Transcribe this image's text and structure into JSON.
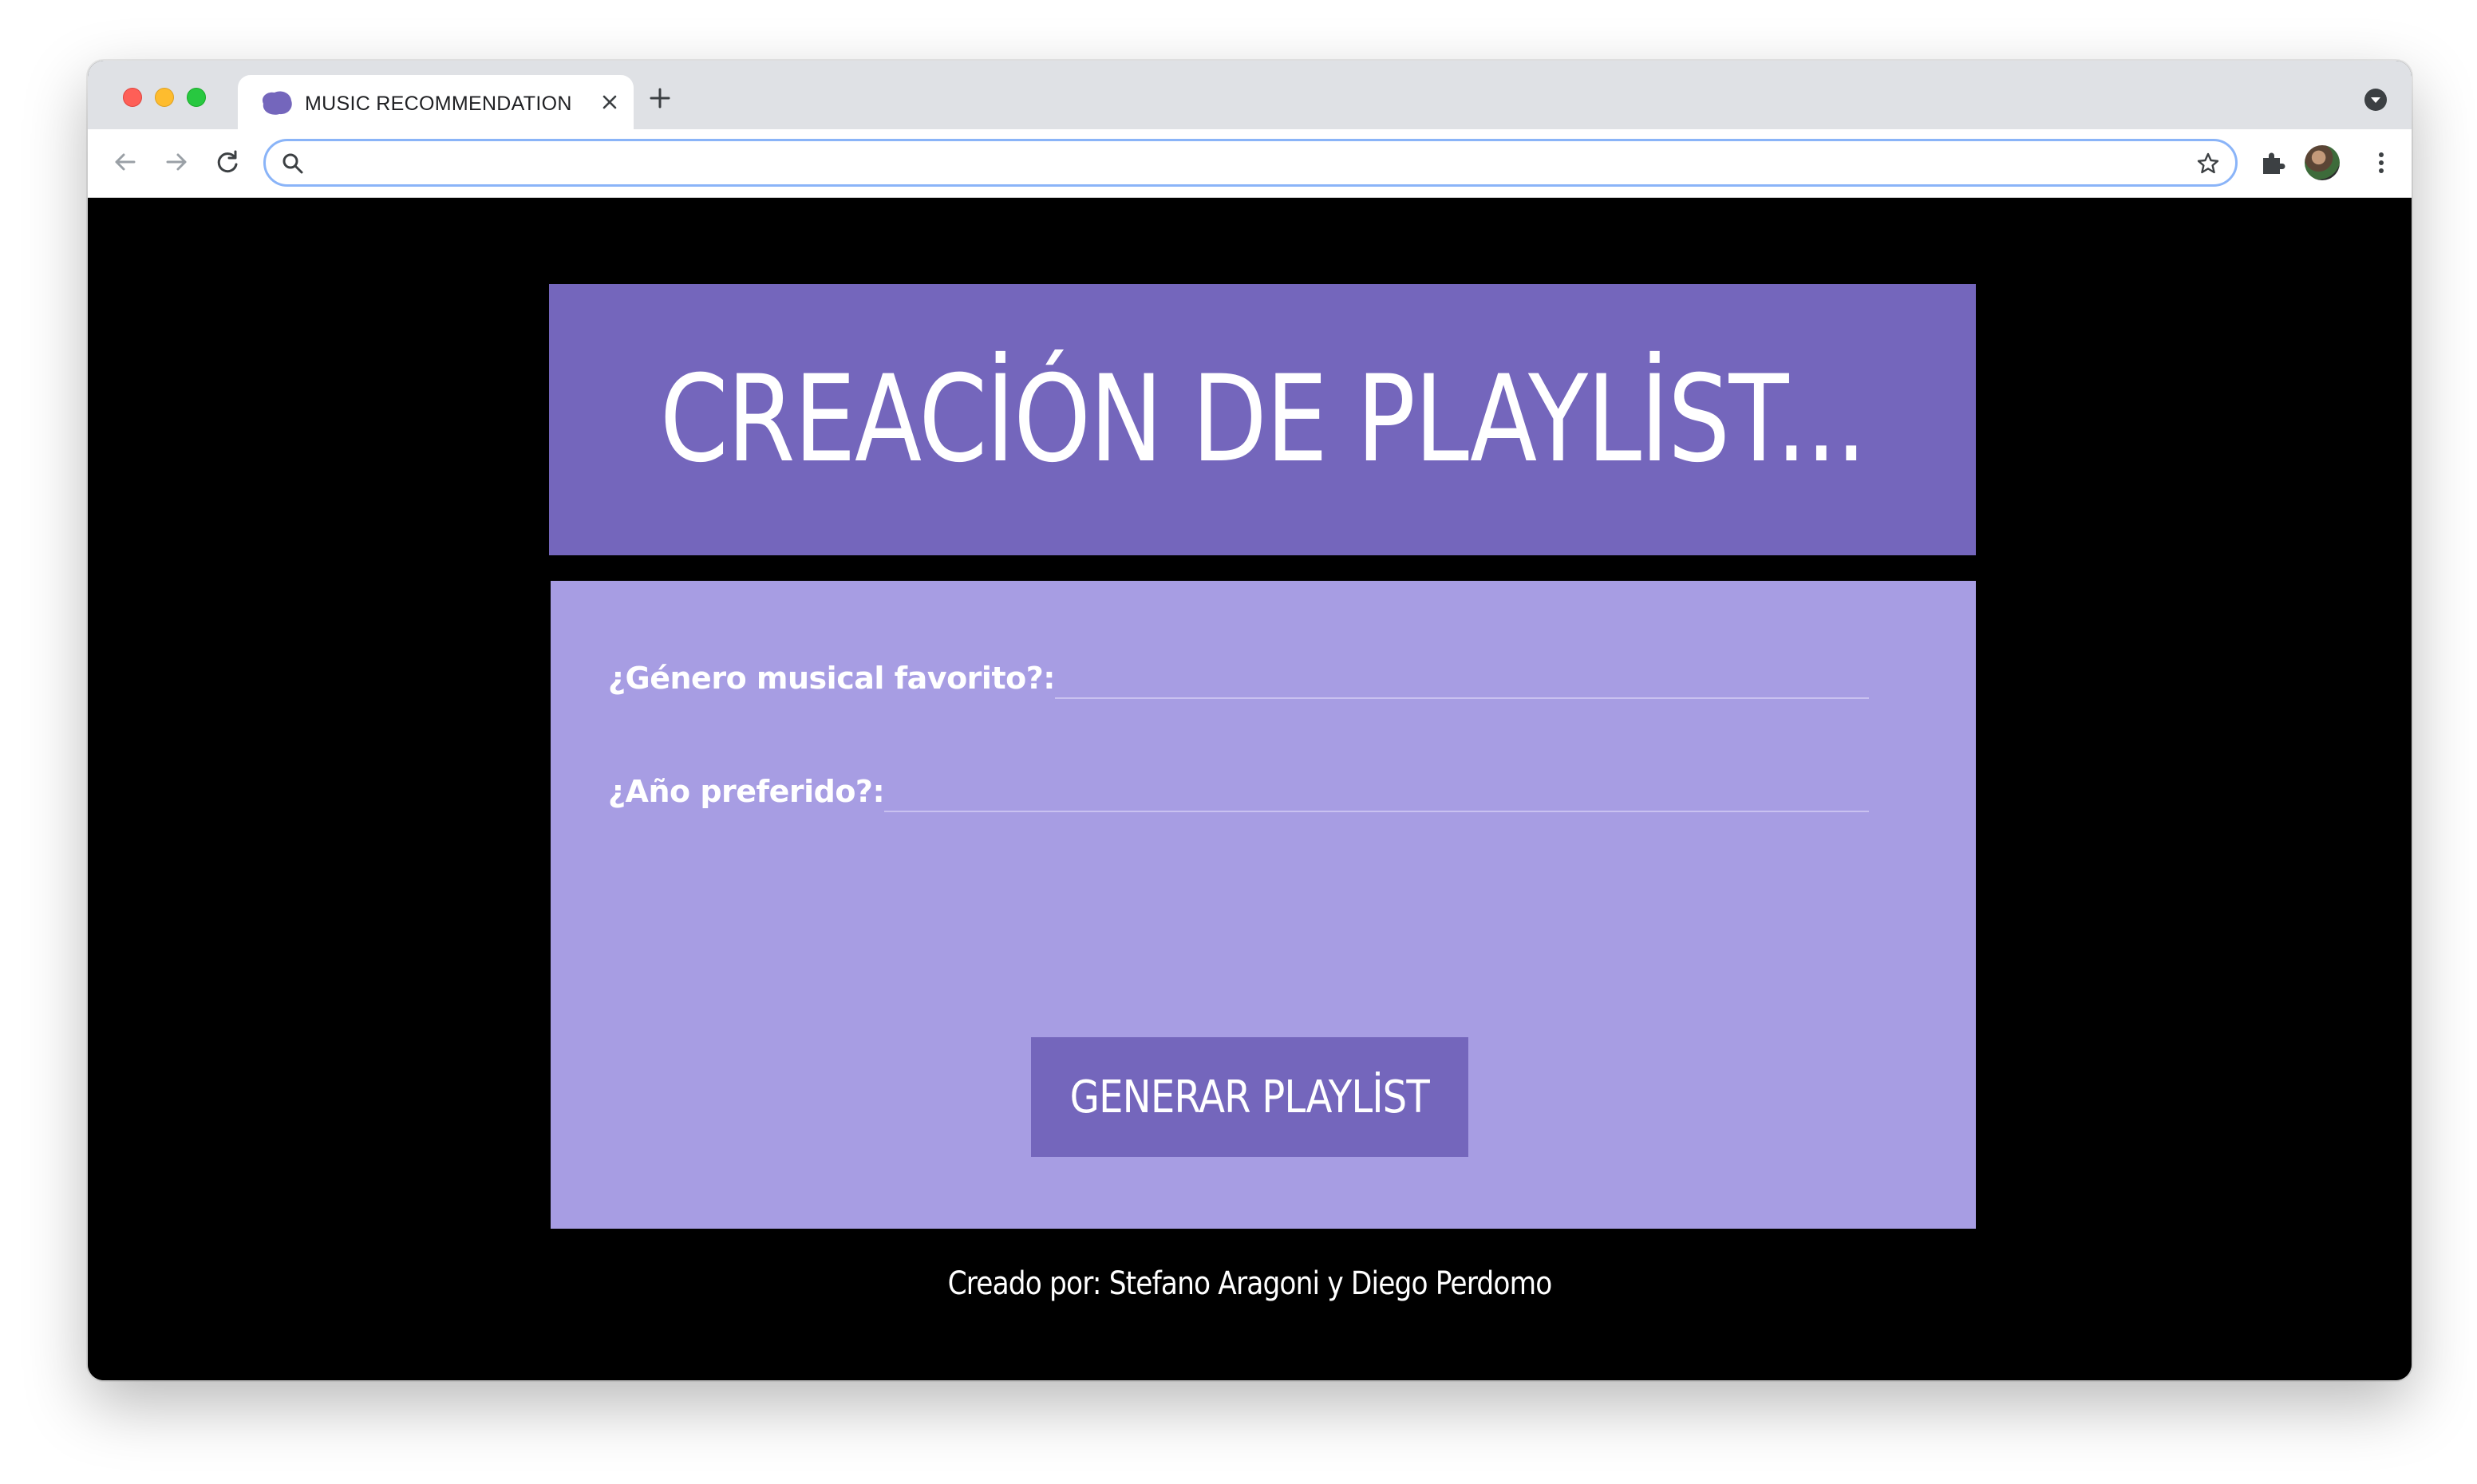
{
  "browser": {
    "tab": {
      "title": "MUSIC RECOMMENDATION",
      "favicon": "purple-blob-icon"
    },
    "address_bar": {
      "value": "",
      "placeholder": ""
    },
    "accent_color": "#8ab4f8"
  },
  "page": {
    "header": {
      "title": "CREACİÓN DE PLAYLİST..."
    },
    "form": {
      "genre_label": "¿Género musical favorito?:",
      "genre_value": "",
      "year_label": "¿Año preferido?:",
      "year_value": "",
      "submit_label": "GENERAR PLAYLİST"
    },
    "footer": {
      "credit": "Creado por: Stefano Aragoni y Diego Perdomo"
    },
    "colors": {
      "background": "#000000",
      "header_bg": "#7466bc",
      "form_bg": "#a79de3",
      "button_bg": "#7466bc",
      "text": "#ffffff"
    }
  }
}
